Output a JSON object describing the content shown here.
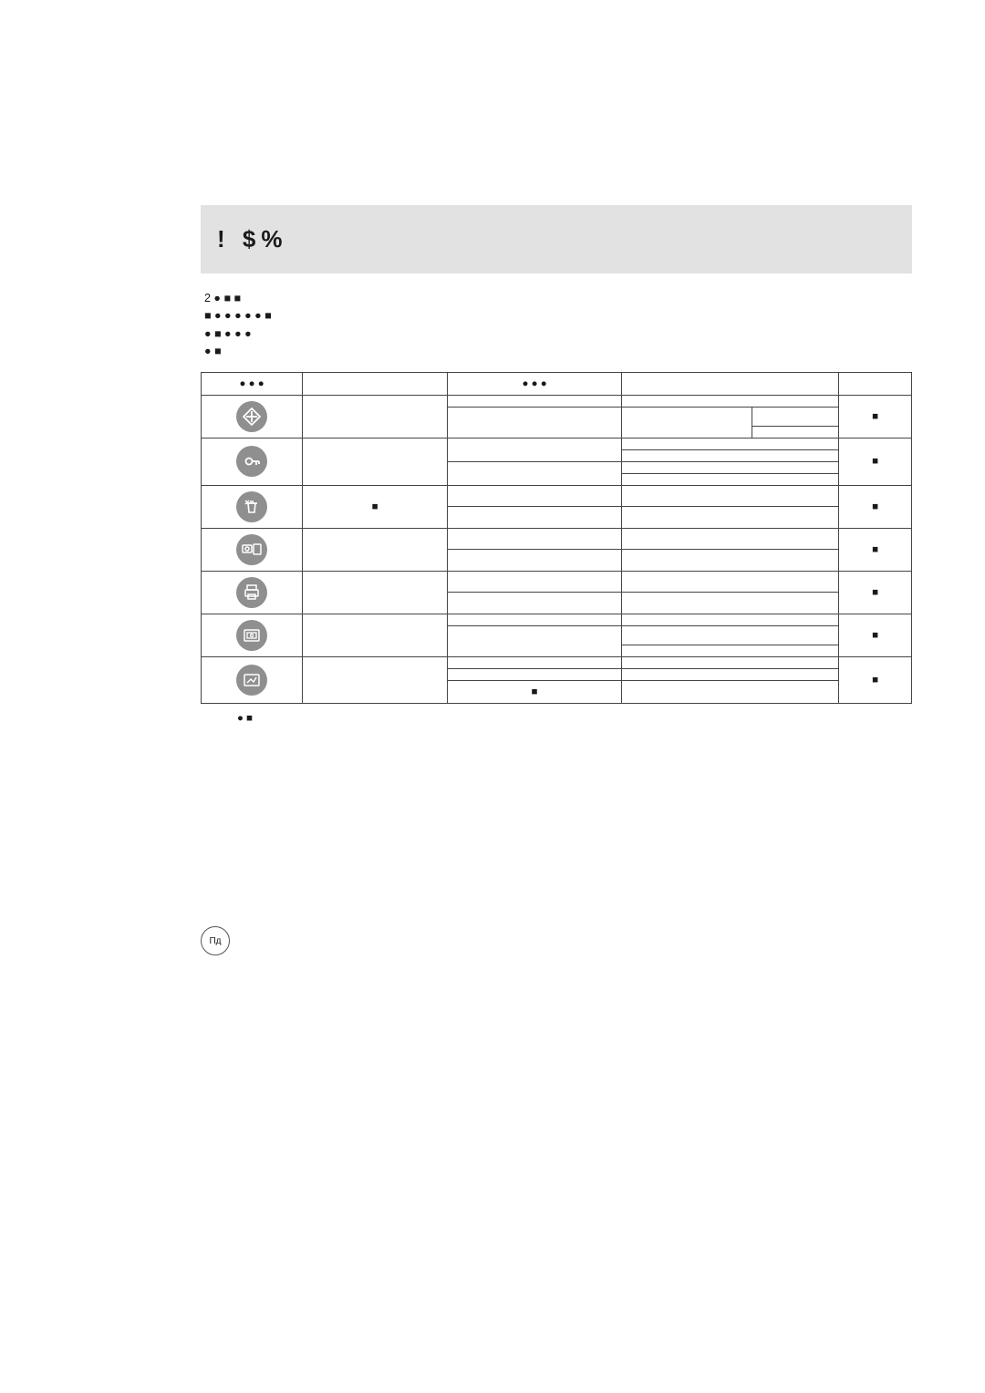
{
  "title": "!           $%",
  "intro_lines": [
    "2   ●  ■        ■",
    "    ■   ● ●    ●   ● ●  ■",
    "       ●  ■ ● ●    ●",
    "       ●  ■"
  ],
  "headers": {
    "icon": "● ●    ●",
    "main": "",
    "sub": "●   ● ●",
    "opt": "",
    "page": ""
  },
  "rows": [
    {
      "icon": "resize-icon",
      "main": "",
      "subs": [
        {
          "label": "",
          "opt": "",
          "opt2": ""
        },
        {
          "label": "",
          "opt": "",
          "opt2": ""
        }
      ],
      "page": "■",
      "subrowspan": 2,
      "twoOptCols": true
    },
    {
      "icon": "key-icon",
      "main": "",
      "subs": [
        {
          "label": "",
          "opt": ""
        },
        {
          "label": "",
          "opt": ""
        },
        {
          "label": "",
          "opt": ""
        },
        {
          "label": "",
          "opt": ""
        }
      ],
      "page": "■"
    },
    {
      "icon": "trash-icon",
      "main": "■",
      "subs": [
        {
          "label": "",
          "opt": ""
        },
        {
          "label": "",
          "opt": ""
        }
      ],
      "page": "■"
    },
    {
      "icon": "camera-card-icon",
      "main": "",
      "subs": [
        {
          "label": "",
          "opt": ""
        },
        {
          "label": "",
          "opt": ""
        }
      ],
      "page": "■"
    },
    {
      "icon": "print-icon",
      "main": "",
      "subs": [
        {
          "label": "",
          "opt": ""
        },
        {
          "label": "",
          "opt": ""
        }
      ],
      "page": "■"
    },
    {
      "icon": "slideshow-icon",
      "main": "",
      "subs": [
        {
          "label": "",
          "opt": ""
        },
        {
          "label": "",
          "opt": ""
        },
        {
          "label": "",
          "opt": ""
        }
      ],
      "page": "■"
    },
    {
      "icon": "resize2-icon",
      "main": "",
      "subs": [
        {
          "label": "",
          "opt": ""
        },
        {
          "label": "",
          "opt": ""
        },
        {
          "label": "■",
          "opt": ""
        }
      ],
      "page": "■"
    }
  ],
  "footnote": "● ■",
  "page_number": "Пд"
}
